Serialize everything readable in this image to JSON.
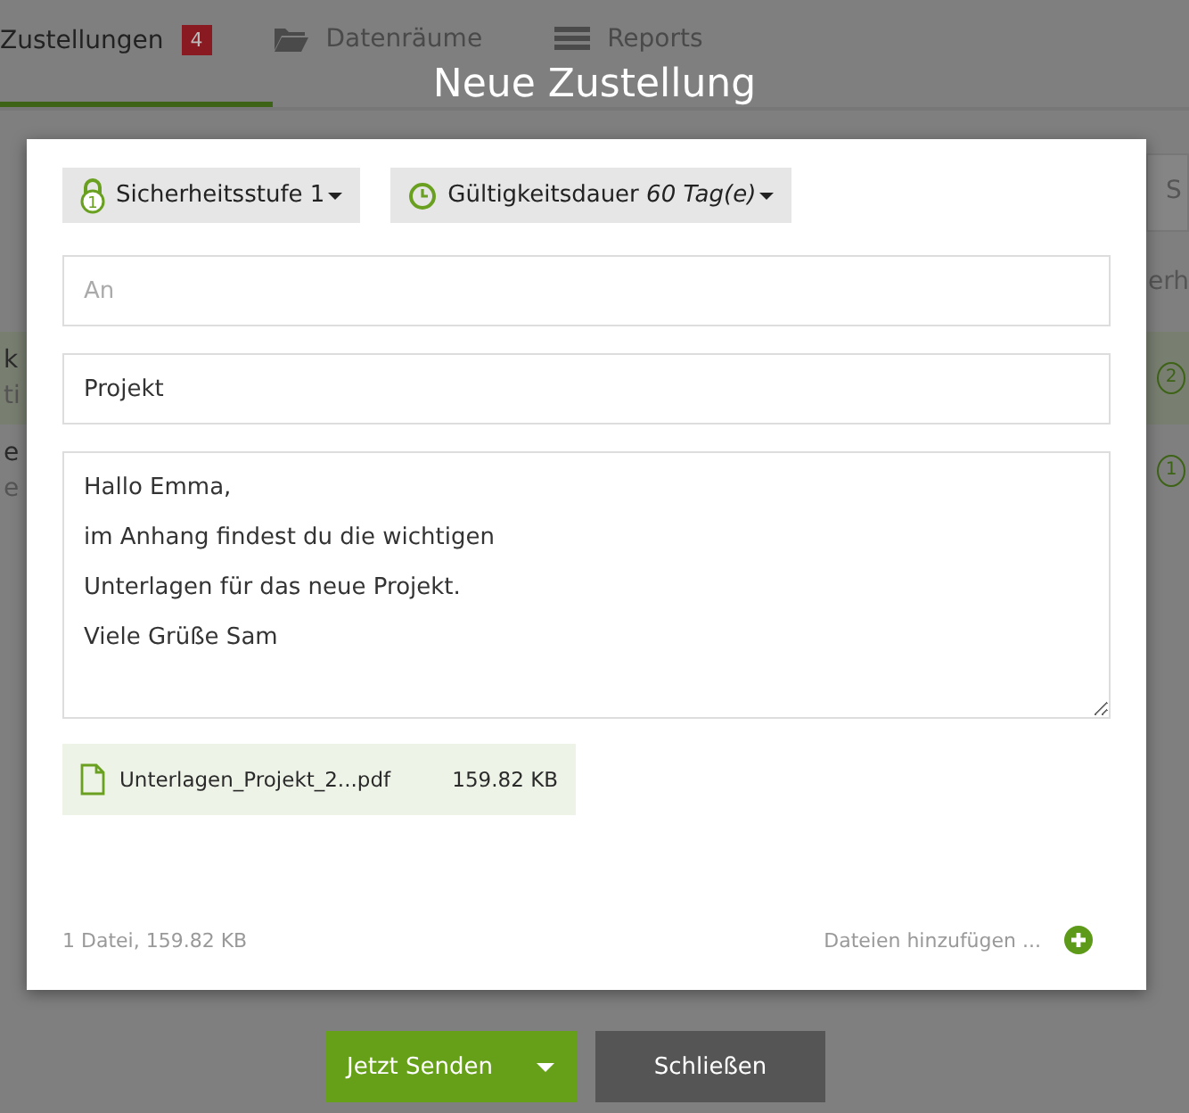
{
  "background": {
    "tabs": [
      {
        "label": "Zustellungen",
        "badge": "4",
        "selected": true
      },
      {
        "label": "Datenräume",
        "selected": false
      },
      {
        "label": "Reports",
        "selected": false
      }
    ],
    "search_fragment": "S",
    "column_fragment": "erh",
    "rows": [
      {
        "line_1": "k",
        "line_2": "ti",
        "level_text": "2"
      },
      {
        "line_1": "e",
        "line_2": "e",
        "level_text": "1"
      }
    ]
  },
  "dialog": {
    "title": "Neue Zustellung",
    "security_button": "Sicherheitsstufe 1",
    "security_level": "1",
    "validity_label": "Gültigkeitsdauer",
    "validity_value": "60 Tag(e)",
    "to_field": {
      "placeholder": "An"
    },
    "subject_field": {
      "value": "Projekt"
    },
    "message_field": {
      "value": "Hallo Emma,\nim Anhang findest du die wichtigen\nUnterlagen für das neue Projekt.\nViele Grüße Sam"
    },
    "attachments": [
      {
        "name": "Unterlagen_Projekt_2...pdf",
        "size": "159.82 KB"
      }
    ],
    "summary": "1 Datei, 159.82 KB",
    "add_files": "Dateien hinzufügen ..."
  },
  "buttons": {
    "send": "Jetzt Senden",
    "close": "Schließen"
  }
}
